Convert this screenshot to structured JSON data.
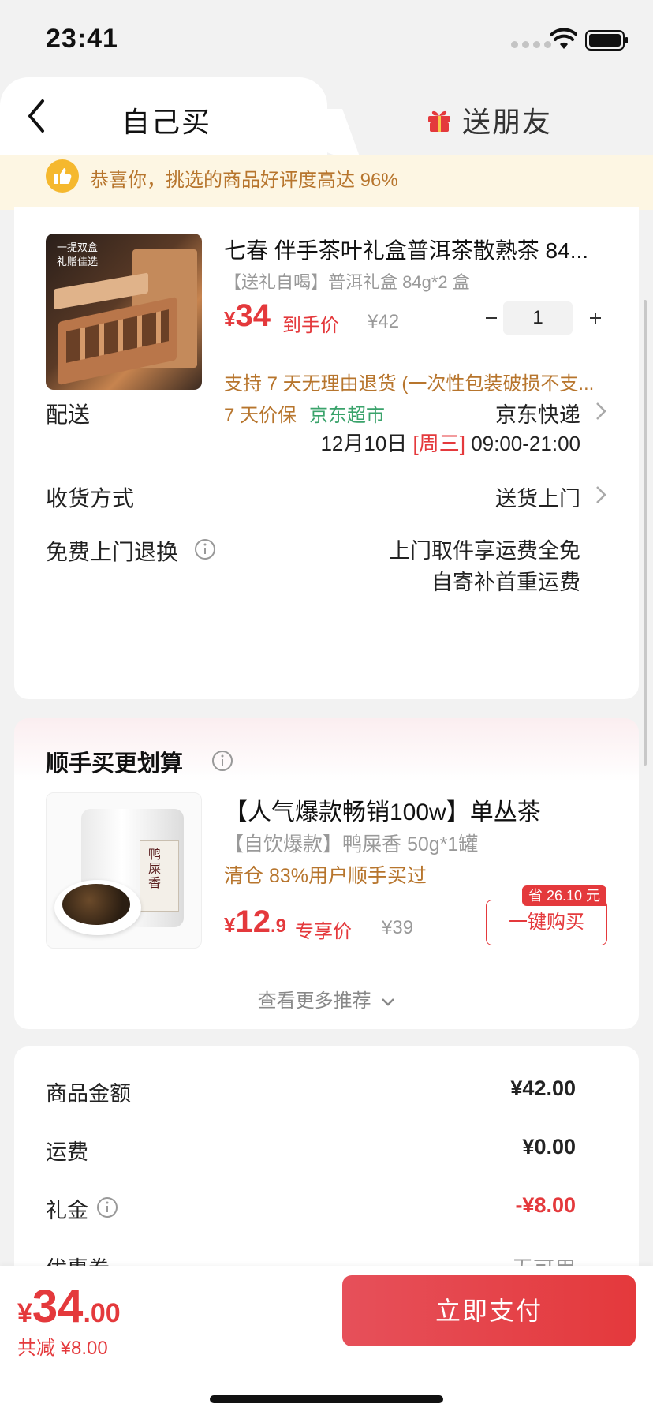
{
  "status_bar": {
    "time": "23:41"
  },
  "header": {
    "tab_self": "自己买",
    "tab_friend": "送朋友"
  },
  "notice": {
    "text": "恭喜你，挑选的商品好评度高达 96%"
  },
  "product": {
    "image_caption": "一提双盒 礼赠佳选",
    "title": "七春 伴手茶叶礼盒普洱茶散熟茶 84...",
    "spec": "【送礼自喝】普洱礼盒 84g*2 盒",
    "price_currency": "¥",
    "price": "34",
    "price_label": "到手价",
    "original_price": "¥42",
    "quantity": "1",
    "policy": "支持 7 天无理由退货 (一次性包装破损不支...",
    "tag_price_protect": "7 天价保",
    "tag_store": "京东超市"
  },
  "delivery": {
    "label": "配送",
    "carrier": "京东快递",
    "date": "12月10日",
    "weekday": "[周三]",
    "window": "09:00-21:00"
  },
  "receive": {
    "label": "收货方式",
    "value": "送货上门"
  },
  "return_service": {
    "label": "免费上门退换",
    "line1": "上门取件享运费全免",
    "line2": "自寄补首重运费"
  },
  "recommendation": {
    "title": "顺手买更划算",
    "item_title": "【人气爆款畅销100w】单丛茶",
    "item_spec": "【自饮爆款】鸭屎香 50g*1罐",
    "item_tag": "清仓  83%用户顺手买过",
    "image_label": "鸭屎香",
    "price_currency": "¥",
    "price_int": "12",
    "price_dec": ".9",
    "price_label": "专享价",
    "original_price": "¥39",
    "save_badge": "省 26.10 元",
    "buy_button": "一键购买",
    "more": "查看更多推荐"
  },
  "summary": {
    "rows": [
      {
        "label": "商品金额",
        "value": "¥42.00"
      },
      {
        "label": "运费",
        "value": "¥0.00"
      },
      {
        "label": "礼金",
        "value": "-¥8.00"
      },
      {
        "label": "优惠券",
        "value": "无可用"
      }
    ]
  },
  "bottom": {
    "currency": "¥",
    "total_int": "34",
    "total_dec": ".00",
    "saved": "共减 ¥8.00",
    "pay_button": "立即支付"
  },
  "colors": {
    "accent_red": "#e4393c",
    "gold": "#b7752d",
    "green": "#3aa36b",
    "banner_bg": "#fdf6e3"
  },
  "icons": [
    "back-icon",
    "gift-icon",
    "thumb-up-icon",
    "info-icon",
    "chevron-right-icon",
    "chevron-down-icon",
    "minus-icon",
    "plus-icon",
    "wifi-icon",
    "battery-icon"
  ]
}
